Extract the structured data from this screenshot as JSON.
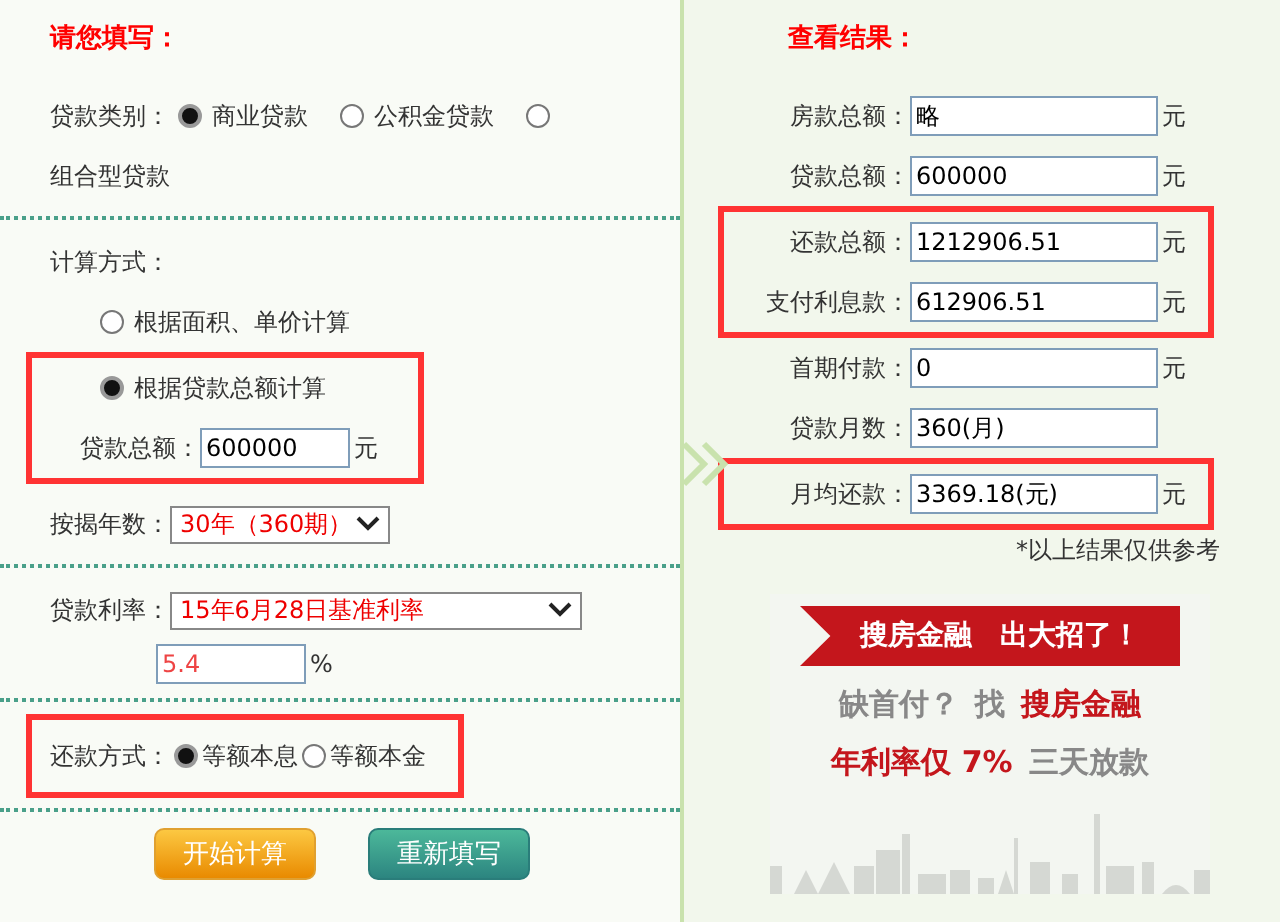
{
  "form": {
    "rows": [
      {
        "kind": "title",
        "text": "请您填写："
      },
      {
        "kind": "radios",
        "label": "贷款类别：",
        "options": [
          {
            "label": "商业贷款",
            "selected": true
          },
          {
            "label": "公积金贷款",
            "selected": false
          },
          {
            "label": "组合型贷款",
            "selected": false
          }
        ],
        "divider_after": true
      },
      {
        "kind": "label",
        "text": "计算方式："
      },
      {
        "kind": "radio",
        "label": "根据面积、单价计算",
        "selected": false
      },
      {
        "kind": "radio",
        "label": "根据贷款总额计算",
        "selected": true,
        "highlighted": true
      },
      {
        "kind": "field",
        "label": "贷款总额：",
        "value": "600000",
        "unit": "元",
        "highlighted": true
      },
      {
        "kind": "select",
        "label": "按揭年数：",
        "value": "30年（360期）",
        "wide": false,
        "divider_after": true
      },
      {
        "kind": "select",
        "label": "贷款利率：",
        "value": "15年6月28日基准利率",
        "wide": true
      },
      {
        "kind": "field",
        "value": "5.4",
        "unit": "%",
        "divider_after": true
      },
      {
        "kind": "radios",
        "label": "还款方式：",
        "options": [
          {
            "label": "等额本息",
            "selected": true
          },
          {
            "label": "等额本金",
            "selected": false
          }
        ],
        "highlighted": true,
        "divider_after": true
      },
      {
        "kind": "buttons",
        "buttons": [
          {
            "label": "开始计算",
            "kind": "primary"
          },
          {
            "label": "重新填写",
            "kind": "secondary"
          }
        ]
      }
    ]
  },
  "results": {
    "title": "查看结果：",
    "rows": [
      {
        "label": "房款总额：",
        "value": "略",
        "unit": "元",
        "highlighted": false
      },
      {
        "label": "贷款总额：",
        "value": "600000",
        "unit": "元",
        "highlighted": false
      },
      {
        "label": "还款总额：",
        "value": "1212906.51",
        "unit": "元",
        "highlighted": true
      },
      {
        "label": "支付利息款：",
        "value": "612906.51",
        "unit": "元",
        "highlighted": true
      },
      {
        "label": "首期付款：",
        "value": "0",
        "unit": "元",
        "highlighted": false
      },
      {
        "label": "贷款月数：",
        "value": "360(月)",
        "highlighted": false
      },
      {
        "label": "月均还款：",
        "value": "3369.18(元)",
        "unit": "元",
        "highlighted": true
      }
    ],
    "note": "*以上结果仅供参考",
    "ad": {
      "ribbon": [
        "搜房金融",
        "出大招了！"
      ],
      "line_1": [
        {
          "text": "缺首付？",
          "kind": "gray"
        },
        {
          "text": "找",
          "kind": "gray"
        },
        {
          "text": "搜房金融",
          "kind": "red"
        }
      ],
      "line_2": [
        {
          "text": "年利率仅 7%",
          "kind": "red"
        },
        {
          "text": "三天放款",
          "kind": "gray"
        }
      ]
    }
  }
}
